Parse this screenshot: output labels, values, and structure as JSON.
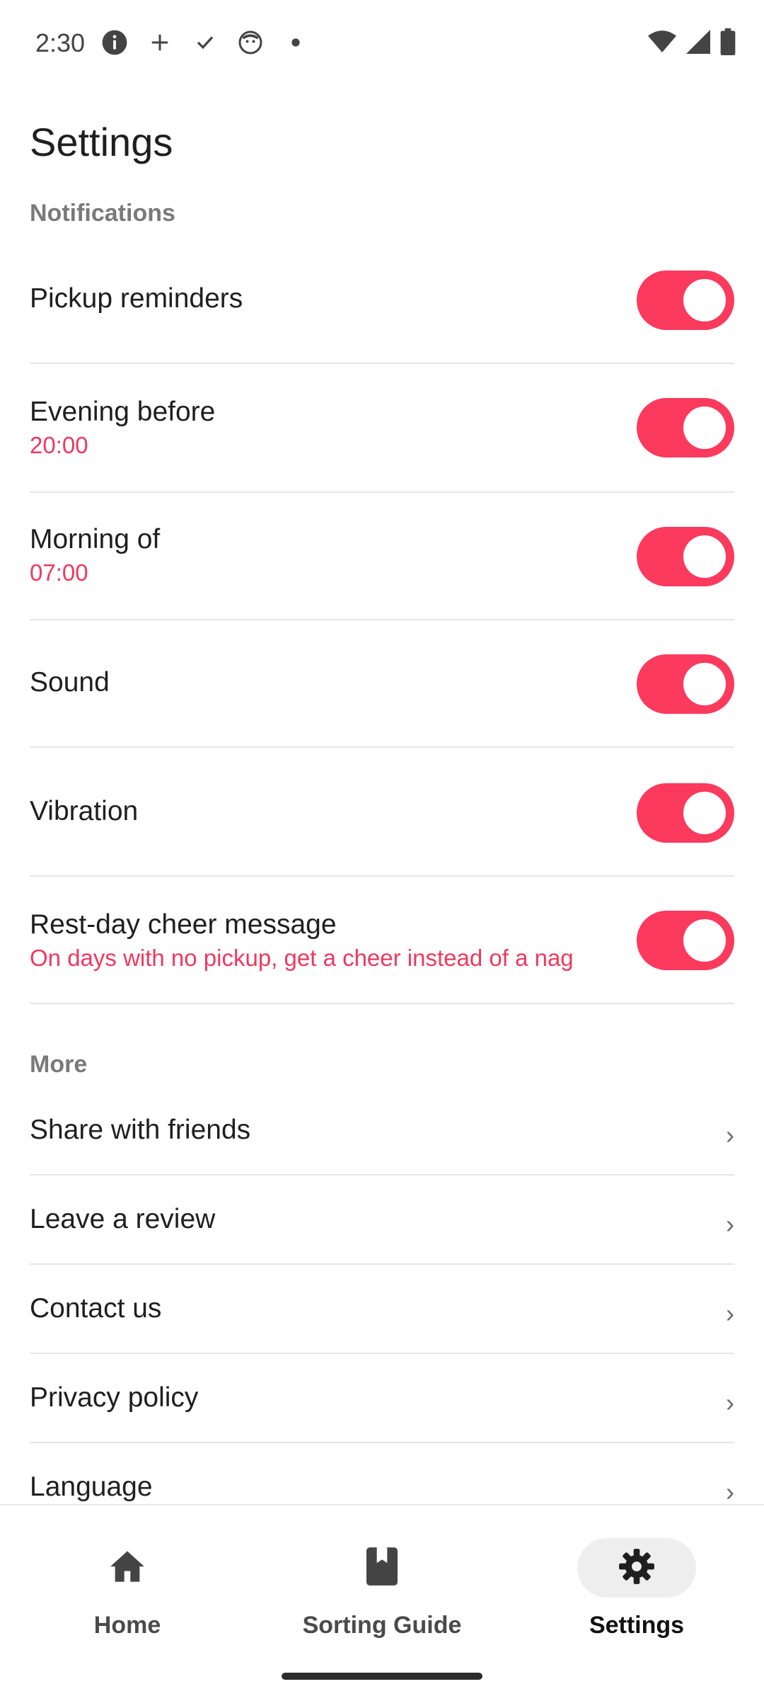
{
  "status_bar": {
    "time": "2:30",
    "left_icons": [
      "info-icon",
      "plus-icon",
      "check-icon",
      "face-icon",
      "dot-icon"
    ],
    "right_icons": [
      "wifi-icon",
      "signal-icon",
      "battery-icon"
    ]
  },
  "page": {
    "title": "Settings"
  },
  "notifications": {
    "label": "Notifications",
    "items": [
      {
        "title": "Pickup reminders",
        "subtitle": "",
        "enabled": true
      },
      {
        "title": "Evening before",
        "subtitle": "20:00",
        "enabled": true
      },
      {
        "title": "Morning of",
        "subtitle": "07:00",
        "enabled": true
      },
      {
        "title": "Sound",
        "subtitle": "",
        "enabled": true
      },
      {
        "title": "Vibration",
        "subtitle": "",
        "enabled": true
      },
      {
        "title": "Rest-day cheer message",
        "subtitle": "On days with no pickup, get a cheer instead of a nag",
        "enabled": true
      }
    ]
  },
  "more": {
    "label": "More",
    "chevron": "›",
    "items": [
      {
        "title": "Share with friends"
      },
      {
        "title": "Leave a review"
      },
      {
        "title": "Contact us"
      },
      {
        "title": "Privacy policy"
      },
      {
        "title": "Language"
      }
    ]
  },
  "bottom_nav": {
    "items": [
      {
        "label": "Home",
        "icon": "home-icon",
        "active": false
      },
      {
        "label": "Sorting Guide",
        "icon": "book-icon",
        "active": false
      },
      {
        "label": "Settings",
        "icon": "gear-icon",
        "active": true
      }
    ]
  },
  "colors": {
    "accent": "#fb3a5e",
    "subtitle": "#f0385f",
    "divider": "#e6e6e6"
  }
}
